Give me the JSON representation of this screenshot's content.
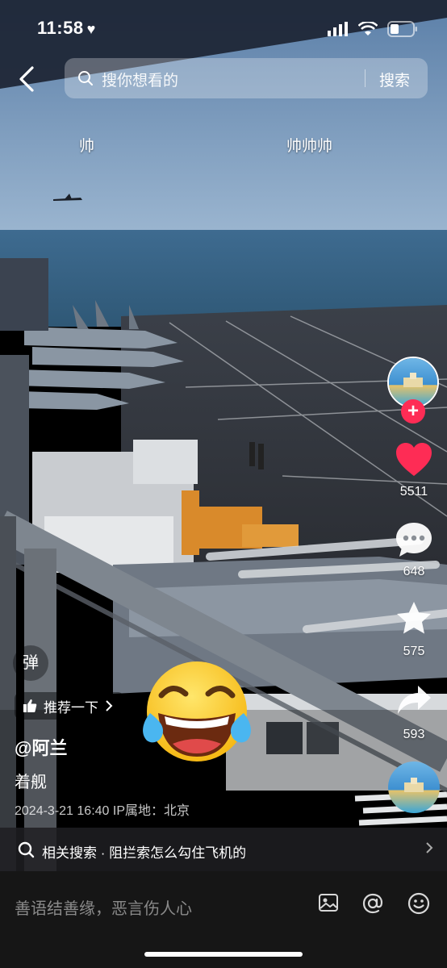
{
  "status_bar": {
    "time": "11:58",
    "heart_icon": "heart-icon",
    "signal_icon": "cellular-signal-icon",
    "wifi_icon": "wifi-icon",
    "battery_icon": "battery-icon"
  },
  "search": {
    "placeholder": "搜你想看的",
    "button_label": "搜索"
  },
  "danmaku": [
    "帅",
    "帅帅帅"
  ],
  "rail": {
    "likes": "5511",
    "comments": "648",
    "favorites": "575",
    "shares": "593",
    "like_color": "#fe2c55",
    "follow_color": "#fe2c55"
  },
  "dan_toggle": "弹",
  "recommend_label": "推荐一下",
  "author": "@阿兰",
  "caption": "着舰",
  "meta": "2024-3-21 16:40  IP属地：北京",
  "related_search": "相关搜索 · 阻拦索怎么勾住飞机的",
  "comment_placeholder": "善语结善缘，恶言伤人心"
}
